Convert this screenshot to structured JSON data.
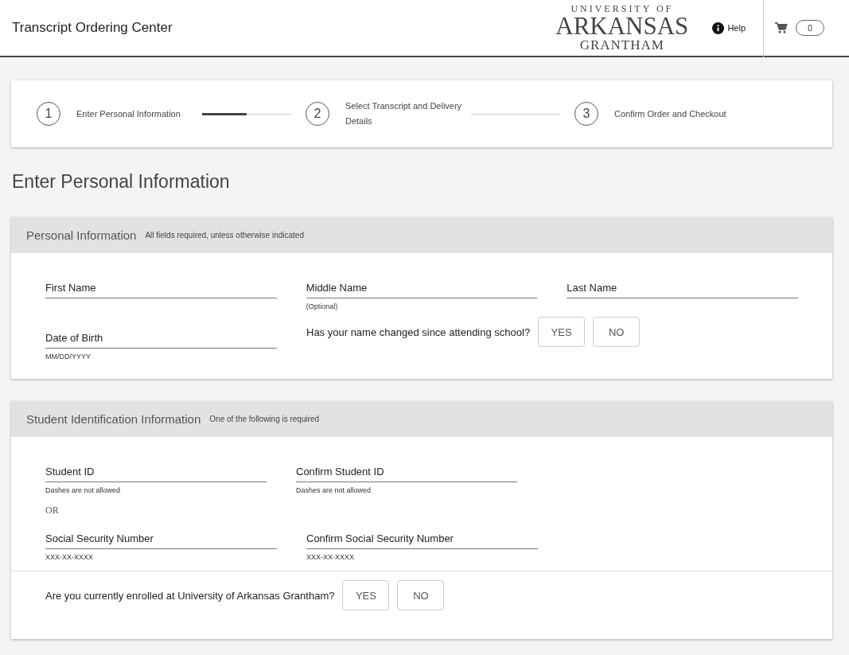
{
  "header": {
    "title": "Transcript Ordering Center",
    "logo": {
      "line_1": "UNIVERSITY OF",
      "line_2": "ARKANSAS",
      "line_3": "GRANTHAM"
    },
    "help": "Help",
    "cart_count": "0"
  },
  "steps": [
    {
      "number": "1",
      "label": "Enter Personal Information",
      "connector": {
        "level": 0.5
      }
    },
    {
      "number": "2",
      "label": "Select Transcript and Delivery Details"
    },
    {
      "number": "3",
      "label": "Confirm Order and Checkout"
    }
  ],
  "page_title": "Enter Personal Information",
  "personal_information": {
    "title": "Personal Information",
    "subtitle": "All fields required, unless otherwise indicated",
    "row_1": [
      {
        "placeholder": "First Name"
      },
      {
        "placeholder": "Middle Name",
        "hint": "(Optional)"
      },
      {
        "placeholder": "Last Name"
      }
    ],
    "date_of_birth": {
      "placeholder": "Date of Birth",
      "hint": "MM/DD/YYYY"
    },
    "name_changed": {
      "question": "Has your name changed since attending school?",
      "options": [
        {
          "label": "YES",
          "selected": false
        },
        {
          "label": "NO",
          "selected": false
        }
      ]
    }
  },
  "student_identification": {
    "title": "Student Identification Information",
    "subtitle": "One of the following is required",
    "row_1": [
      {
        "placeholder": "Student ID",
        "hint": "Dashes are not allowed"
      },
      {
        "placeholder": "Confirm Student ID",
        "hint": "Dashes are not allowed"
      }
    ],
    "separator": "OR",
    "row_2": [
      {
        "placeholder": "Social Security Number",
        "hint": "XXX-XX-XXXX"
      },
      {
        "placeholder": "Confirm Social Security Number",
        "hint": "XXX-XX-XXXX"
      }
    ],
    "enrolled": {
      "question": "Are you currently enrolled at University of Arkansas Grantham?",
      "options": [
        {
          "label": "YES",
          "selected": false
        },
        {
          "label": "NO",
          "selected": false
        }
      ]
    }
  }
}
